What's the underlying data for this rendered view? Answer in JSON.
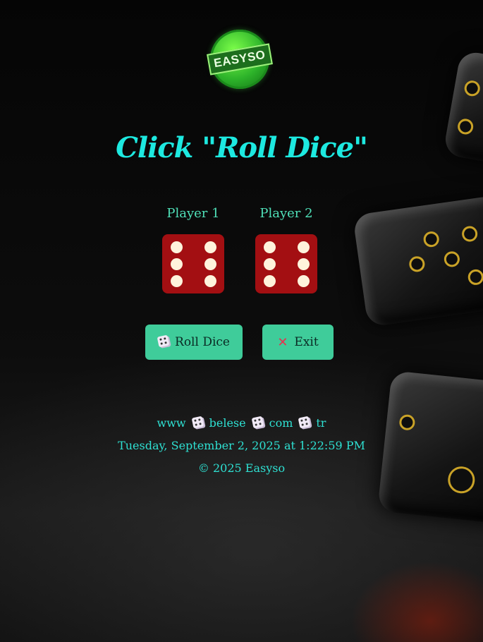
{
  "logo": {
    "text": "EASYSO"
  },
  "title": "Click \"Roll Dice\"",
  "players": [
    {
      "label": "Player 1",
      "die_value": 6
    },
    {
      "label": "Player 2",
      "die_value": 6
    }
  ],
  "buttons": {
    "roll": {
      "label": "Roll Dice",
      "icon": "dice-icon"
    },
    "exit": {
      "label": "Exit",
      "icon": "cross-mark-icon"
    }
  },
  "footer": {
    "url_parts": [
      "www",
      "belese",
      "com",
      "tr"
    ],
    "url_separator_icon": "dice-icon",
    "datetime": "Tuesday, September 2, 2025 at 1:22:59 PM",
    "copyright": "© 2025 Easyso"
  },
  "colors": {
    "accent_cyan": "#1de9e0",
    "button_bg": "#3fcc9a",
    "die_red": "#a30f12",
    "pip": "#fff3dc"
  }
}
